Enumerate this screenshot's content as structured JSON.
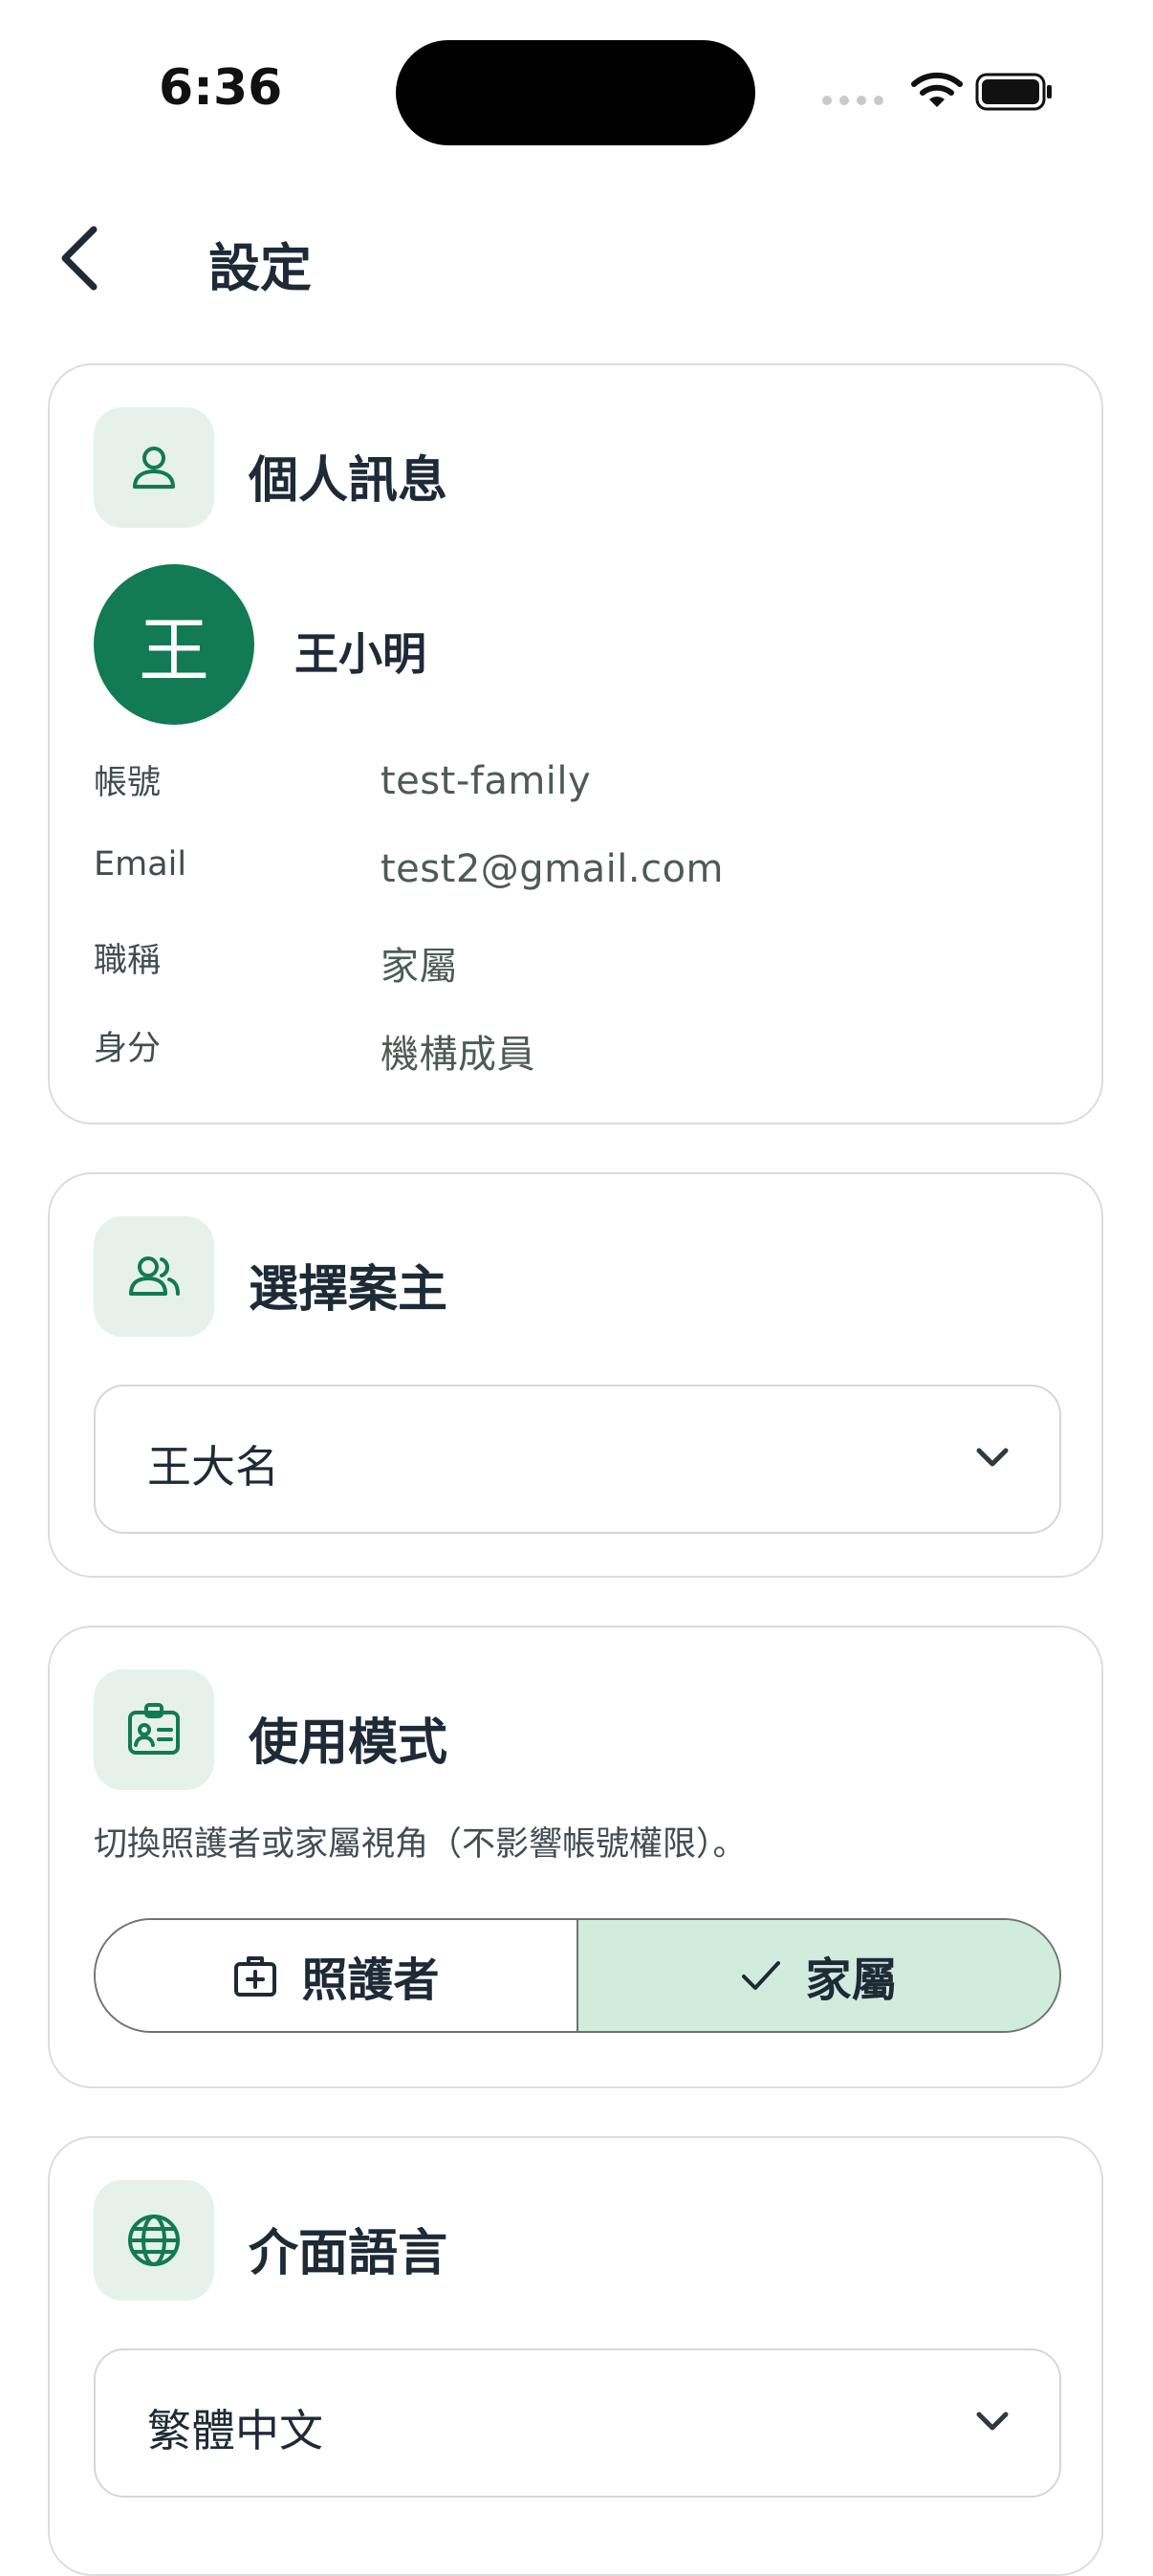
{
  "status_bar": {
    "time": "6:36"
  },
  "header": {
    "title": "設定"
  },
  "profile": {
    "section_title": "個人訊息",
    "avatar_initial": "王",
    "name": "王小明",
    "fields": [
      {
        "label": "帳號",
        "value": "test-family"
      },
      {
        "label": "Email",
        "value": "test2@gmail.com"
      },
      {
        "label": "職稱",
        "value": "家屬"
      },
      {
        "label": "身分",
        "value": "機構成員"
      }
    ]
  },
  "client": {
    "section_title": "選擇案主",
    "selected": "王大名"
  },
  "mode": {
    "section_title": "使用模式",
    "description": "切換照護者或家屬視角（不影響帳號權限）。",
    "options": [
      {
        "label": "照護者",
        "icon": "medical-bag-icon",
        "selected": false
      },
      {
        "label": "家屬",
        "icon": "check-icon",
        "selected": true
      }
    ]
  },
  "language": {
    "section_title": "介面語言",
    "selected": "繁體中文"
  },
  "colors": {
    "accent": "#127a55",
    "icon_bg": "#e6f1ec",
    "selected_bg": "#d1ebdd"
  }
}
